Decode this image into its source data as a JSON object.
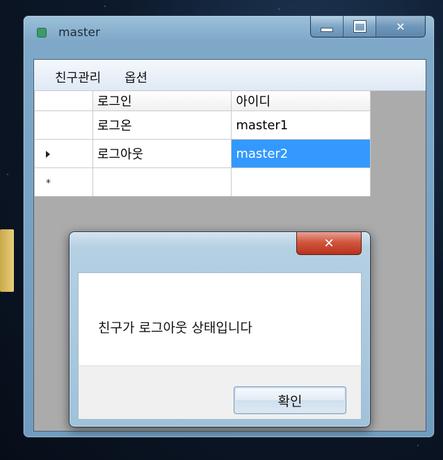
{
  "window": {
    "title": "master"
  },
  "menu": [
    {
      "label": "친구관리"
    },
    {
      "label": "옵션"
    }
  ],
  "grid": {
    "columns": [
      "로그인",
      "아이디"
    ],
    "rows": [
      {
        "indicator": "",
        "status": "로그온",
        "id": "master1"
      },
      {
        "indicator": "current-row-arrow",
        "status": "로그아웃",
        "id": "master2",
        "selected_cell": "id"
      },
      {
        "indicator": "*",
        "status": "",
        "id": ""
      }
    ]
  },
  "dialog": {
    "message": "친구가 로그아웃 상태입니다",
    "ok_label": "확인"
  },
  "colors": {
    "selection": "#3399ff",
    "close_button": "#c8412a"
  }
}
